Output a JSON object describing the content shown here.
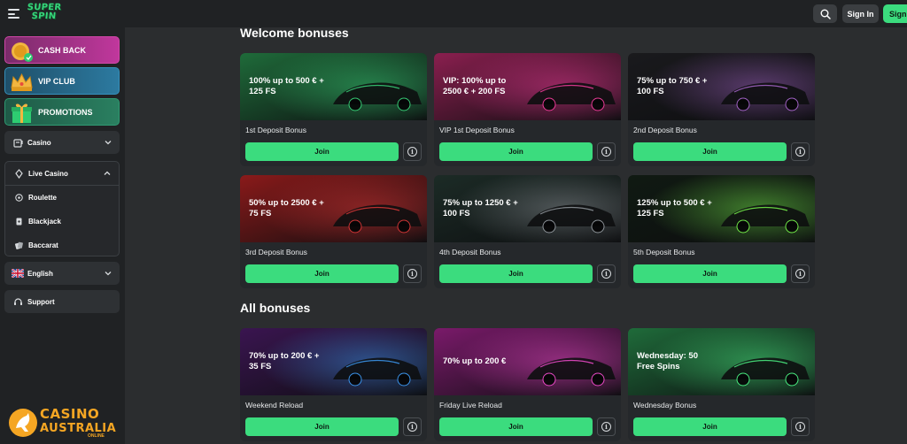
{
  "header": {
    "logo_line1": "SUPER",
    "logo_line2": "SPIN",
    "signin_label": "Sign In",
    "signup_label": "Sign"
  },
  "sidebar": {
    "promos": [
      {
        "label": "CASH BACK",
        "icon": "cashback-icon"
      },
      {
        "label": "VIP CLUB",
        "icon": "crown-icon"
      },
      {
        "label": "PROMOTIONS",
        "icon": "gift-icon"
      }
    ],
    "casino_label": "Casino",
    "live_casino_label": "Live Casino",
    "live_items": [
      {
        "label": "Roulette",
        "icon": "roulette-icon"
      },
      {
        "label": "Blackjack",
        "icon": "cards-icon"
      },
      {
        "label": "Baccarat",
        "icon": "baccarat-icon"
      }
    ],
    "language_label": "English",
    "support_label": "Support"
  },
  "welcome": {
    "title": "Welcome bonuses",
    "cards": [
      {
        "headline": "100% up to 500 € +\n125 FS",
        "name": "1st Deposit Bonus",
        "join": "Join",
        "theme": "#1f6b3a"
      },
      {
        "headline": "VIP: 100% up to\n2500 € + 200 FS",
        "name": "VIP 1st Deposit Bonus",
        "join": "Join",
        "theme": "#8a1f4f"
      },
      {
        "headline": "75% up to 750 € +\n100 FS",
        "name": "2nd Deposit Bonus",
        "join": "Join",
        "theme": "#1a1a1d"
      },
      {
        "headline": "50% up to 2500 € +\n75 FS",
        "name": "3rd Deposit Bonus",
        "join": "Join",
        "theme": "#8a1a1a"
      },
      {
        "headline": "75% up to 1250 € +\n100 FS",
        "name": "4th Deposit Bonus",
        "join": "Join",
        "theme": "#1c2b26"
      },
      {
        "headline": "125% up to 500 € +\n125 FS",
        "name": "5th Deposit Bonus",
        "join": "Join",
        "theme": "#101a12"
      }
    ]
  },
  "all": {
    "title": "All bonuses",
    "cards": [
      {
        "headline": "70% up to 200 € +\n35 FS",
        "name": "Weekend Reload",
        "join": "Join",
        "theme": "#3a1550"
      },
      {
        "headline": "70% up to 200 €",
        "name": "Friday Live Reload",
        "join": "Join",
        "theme": "#7a1a6a"
      },
      {
        "headline": "Wednesday: 50\nFree Spins",
        "name": "Wednesday Bonus",
        "join": "Join",
        "theme": "#1f6b3a"
      }
    ]
  },
  "watermark": {
    "line1": "CASINO",
    "line2": "AUSTRALIA",
    "line3": "ONLINE"
  },
  "colors": {
    "accent_green": "#3bdc7e",
    "background": "#2b2d2f",
    "panel": "#202224"
  }
}
